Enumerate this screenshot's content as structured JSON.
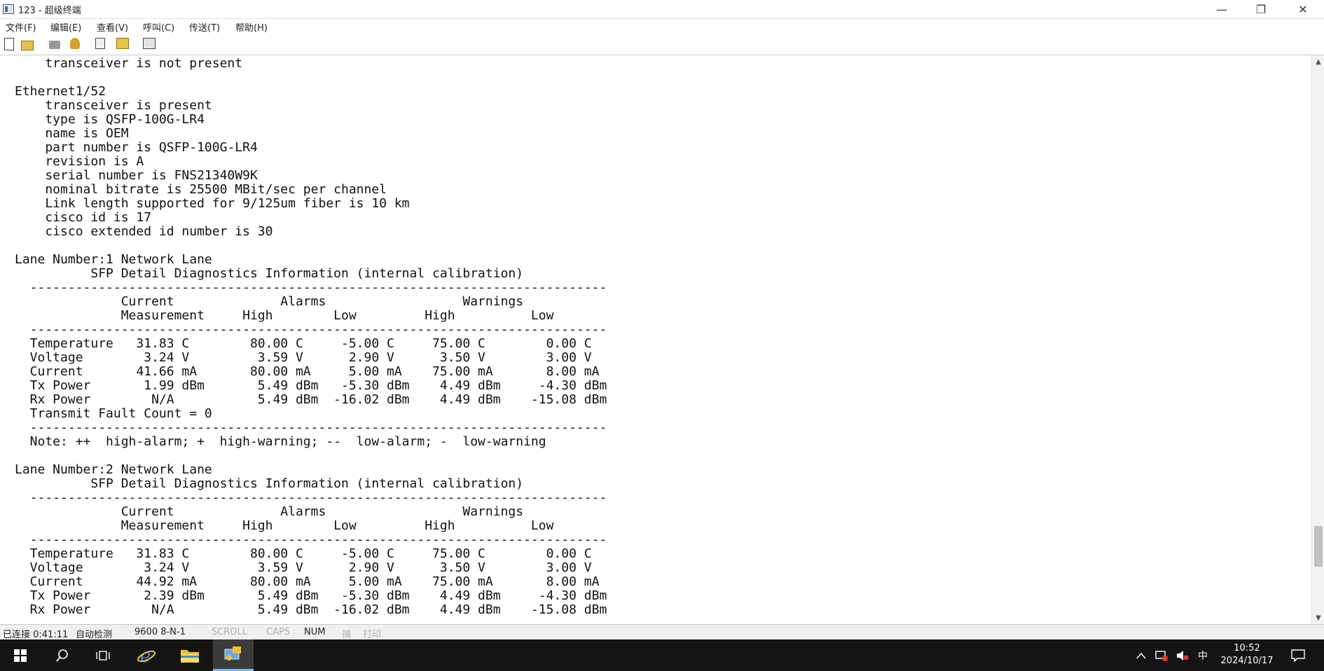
{
  "window": {
    "title": "123 - 超级终端",
    "controls": {
      "minimize": "—",
      "maximize": "❐",
      "close": "✕"
    }
  },
  "menu": [
    {
      "label": "文件(F)"
    },
    {
      "label": "编辑(E)"
    },
    {
      "label": "查看(V)"
    },
    {
      "label": "呼叫(C)"
    },
    {
      "label": "传送(T)"
    },
    {
      "label": "帮助(H)"
    }
  ],
  "toolbar_icons": [
    "new-icon",
    "open-icon",
    "disconnect-icon",
    "connect-icon",
    "send-file-icon",
    "receive-file-icon",
    "properties-icon"
  ],
  "terminal": {
    "lines": [
      "    transceiver is not present",
      "",
      "Ethernet1/52",
      "    transceiver is present",
      "    type is QSFP-100G-LR4",
      "    name is OEM",
      "    part number is QSFP-100G-LR4",
      "    revision is A",
      "    serial number is FNS21340W9K",
      "    nominal bitrate is 25500 MBit/sec per channel",
      "    Link length supported for 9/125um fiber is 10 km",
      "    cisco id is 17",
      "    cisco extended id number is 30",
      "",
      "Lane Number:1 Network Lane",
      "          SFP Detail Diagnostics Information (internal calibration)",
      "  ----------------------------------------------------------------------------",
      "              Current              Alarms                  Warnings",
      "              Measurement     High        Low         High          Low",
      "  ----------------------------------------------------------------------------",
      "  Temperature   31.83 C        80.00 C     -5.00 C     75.00 C        0.00 C",
      "  Voltage        3.24 V         3.59 V      2.90 V      3.50 V        3.00 V",
      "  Current       41.66 mA       80.00 mA     5.00 mA    75.00 mA       8.00 mA",
      "  Tx Power       1.99 dBm       5.49 dBm   -5.30 dBm    4.49 dBm     -4.30 dBm",
      "  Rx Power        N/A           5.49 dBm  -16.02 dBm    4.49 dBm    -15.08 dBm",
      "  Transmit Fault Count = 0",
      "  ----------------------------------------------------------------------------",
      "  Note: ++  high-alarm; +  high-warning; --  low-alarm; -  low-warning",
      "",
      "Lane Number:2 Network Lane",
      "          SFP Detail Diagnostics Information (internal calibration)",
      "  ----------------------------------------------------------------------------",
      "              Current              Alarms                  Warnings",
      "              Measurement     High        Low         High          Low",
      "  ----------------------------------------------------------------------------",
      "  Temperature   31.83 C        80.00 C     -5.00 C     75.00 C        0.00 C",
      "  Voltage        3.24 V         3.59 V      2.90 V      3.50 V        3.00 V",
      "  Current       44.92 mA       80.00 mA     5.00 mA    75.00 mA       8.00 mA",
      "  Tx Power       2.39 dBm       5.49 dBm   -5.30 dBm    4.49 dBm     -4.30 dBm",
      "  Rx Power        N/A           5.49 dBm  -16.02 dBm    4.49 dBm    -15.08 dBm"
    ]
  },
  "scrollbar": {
    "up": "▲",
    "down": "▼",
    "position_fraction": 0.86
  },
  "statusbar": {
    "connected": "已连接 0:41:11",
    "detect": "自动检测",
    "port": "9600 8-N-1",
    "scroll": "SCROLL",
    "caps": "CAPS",
    "num": "NUM",
    "capture": "捕",
    "print": "打印"
  },
  "taskbar": {
    "tray_ime": "中",
    "time": "10:52",
    "date": "2024/10/17"
  }
}
